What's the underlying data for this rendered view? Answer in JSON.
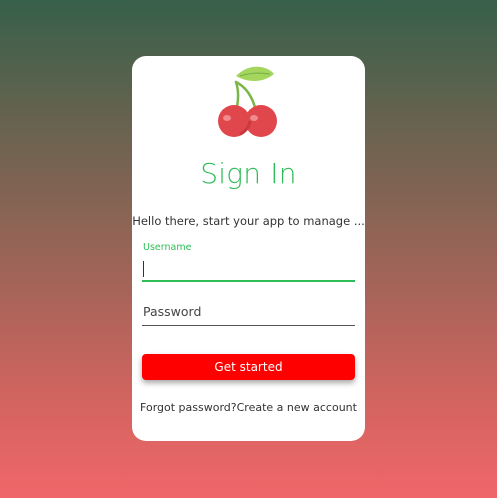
{
  "colors": {
    "accent": "#2fbd58",
    "button": "#ff0000",
    "card": "#ffffff"
  },
  "logo": {
    "icon": "cherry-icon"
  },
  "title": "Sign In",
  "subtitle": "Hello there, start your app to manage ...",
  "username": {
    "label": "Username",
    "value": ""
  },
  "password": {
    "placeholder": "Password",
    "value": ""
  },
  "button_label": "Get started",
  "links": {
    "forgot": "Forgot password?",
    "create": "Create a new account"
  }
}
